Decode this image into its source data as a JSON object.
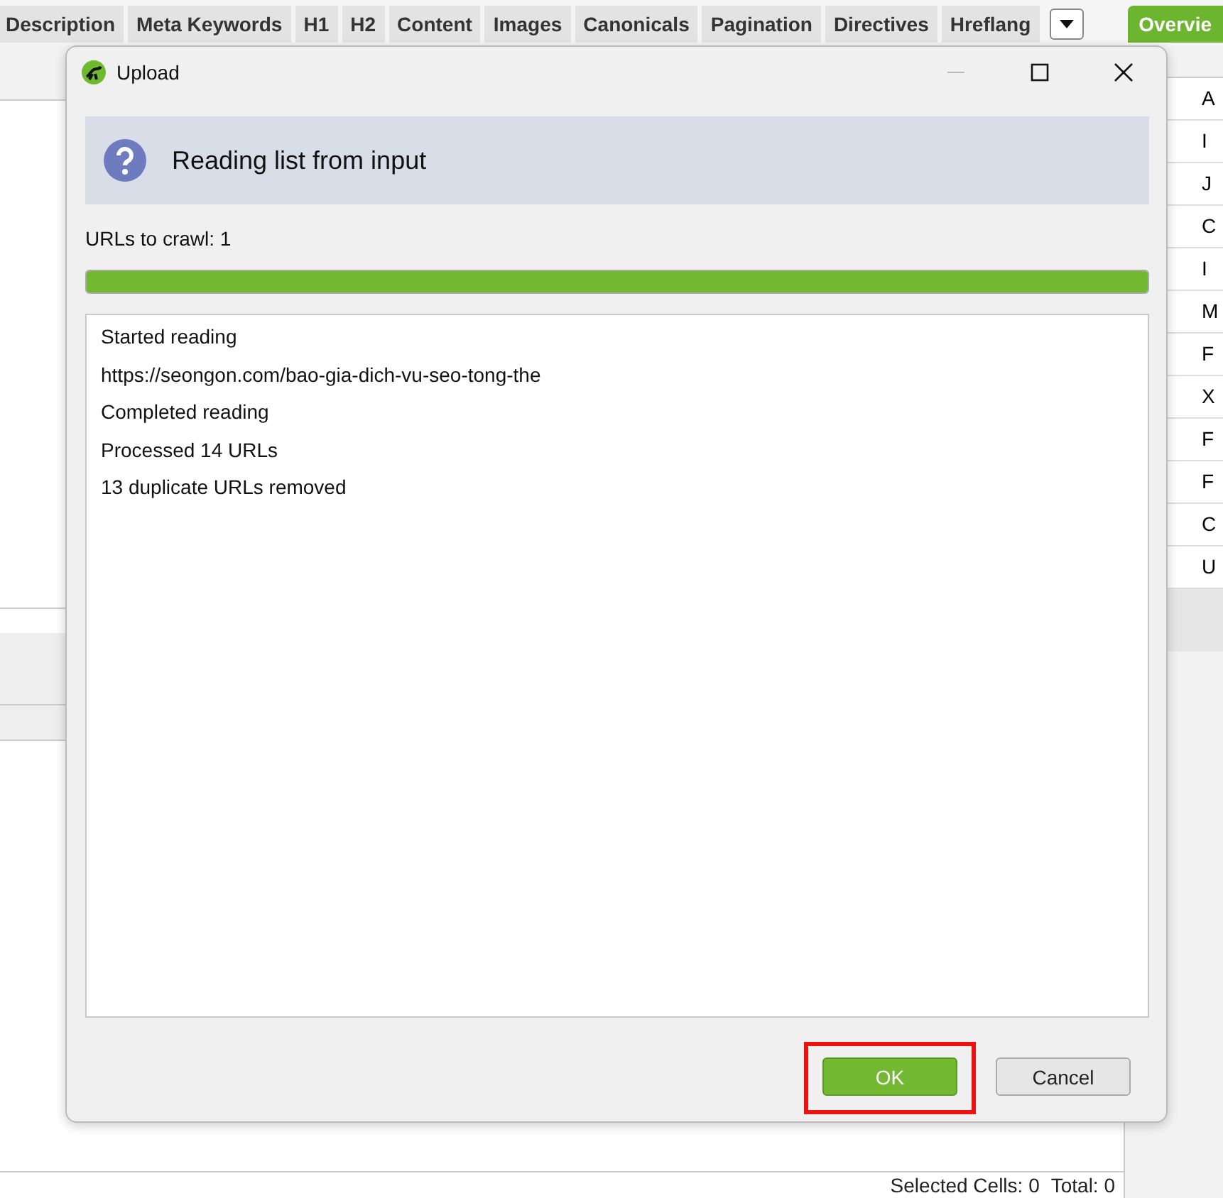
{
  "tabs": [
    {
      "label": "Description",
      "selected": false
    },
    {
      "label": "Meta Keywords",
      "selected": false
    },
    {
      "label": "H1",
      "selected": false
    },
    {
      "label": "H2",
      "selected": false
    },
    {
      "label": "Content",
      "selected": false
    },
    {
      "label": "Images",
      "selected": false
    },
    {
      "label": "Canonicals",
      "selected": false
    },
    {
      "label": "Pagination",
      "selected": false
    },
    {
      "label": "Directives",
      "selected": false
    },
    {
      "label": "Hreflang",
      "selected": false
    }
  ],
  "side_tabs": [
    {
      "label": "Overvie",
      "selected": true
    }
  ],
  "side_rows": [
    "A",
    "I",
    "J",
    "C",
    "I",
    "M",
    "F",
    "X",
    "F",
    "F",
    "C",
    "U"
  ],
  "status_bar": {
    "selected_cells": "Selected Cells: 0",
    "total": "Total: 0"
  },
  "dialog": {
    "title": "Upload",
    "heading": "Reading list from input",
    "urls_to_crawl": "URLs to crawl: 1",
    "progress": {
      "level": 1
    },
    "log": [
      "Started reading",
      "https://seongon.com/bao-gia-dich-vu-seo-tong-the",
      "Completed reading",
      "Processed 14 URLs",
      "13 duplicate URLs removed"
    ],
    "buttons": [
      {
        "label": "OK",
        "kind": "primary",
        "highlighted": true
      },
      {
        "label": "Cancel",
        "kind": "secondary",
        "highlighted": false
      }
    ]
  }
}
